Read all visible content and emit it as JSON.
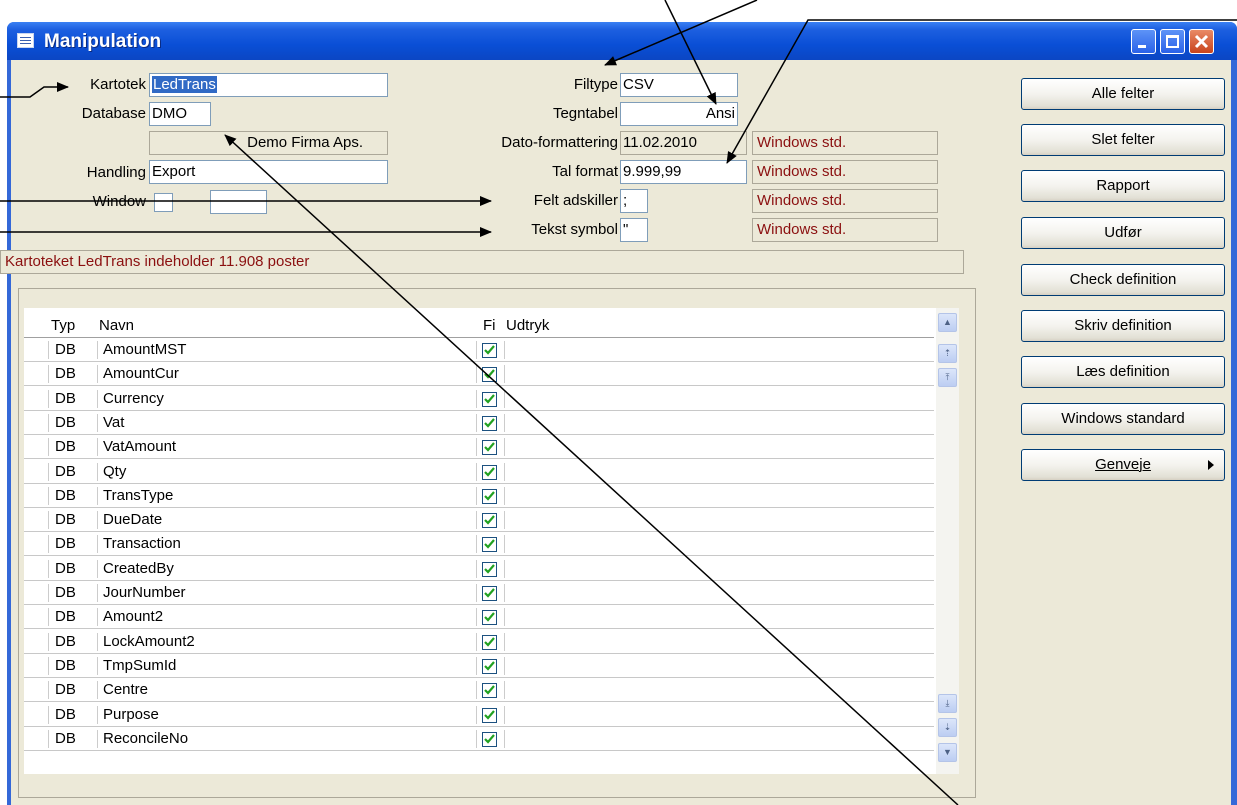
{
  "window": {
    "title": "Manipulation"
  },
  "form": {
    "kartotek_label": "Kartotek",
    "kartotek_value": "LedTrans",
    "database_label": "Database",
    "database_value": "DMO",
    "company_name": "Demo Firma Aps.",
    "handling_label": "Handling",
    "handling_value": "Export",
    "window_label": "Window",
    "window_value": "",
    "filtype_label": "Filtype",
    "filtype_value": "CSV",
    "tegntabel_label": "Tegntabel",
    "tegntabel_value": "Ansi",
    "dato_label": "Dato-formattering",
    "dato_value": "11.02.2010",
    "dato_std": "Windows std.",
    "tal_label": "Tal format",
    "tal_value": "9.999,99",
    "tal_std": "Windows std.",
    "felt_label": "Felt adskiller",
    "felt_value": ";",
    "felt_std": "Windows std.",
    "tekst_label": "Tekst symbol",
    "tekst_value": "\"",
    "tekst_std": "Windows std."
  },
  "status": {
    "message": "Kartoteket LedTrans indeholder 11.908 poster"
  },
  "buttons": {
    "alle_felter": "Alle felter",
    "slet_felter": "Slet felter",
    "rapport": "Rapport",
    "udfor": "Udfør",
    "check_definition": "Check definition",
    "skriv_definition": "Skriv definition",
    "laes_definition": "Læs definition",
    "windows_standard": "Windows standard",
    "genveje": "Genveje"
  },
  "grid": {
    "headers": {
      "typ": "Typ",
      "navn": "Navn",
      "fi": "Fi",
      "udtryk": "Udtryk"
    },
    "rows": [
      {
        "typ": "DB",
        "navn": "AmountMST",
        "checked": true
      },
      {
        "typ": "DB",
        "navn": "AmountCur",
        "checked": true
      },
      {
        "typ": "DB",
        "navn": "Currency",
        "checked": true
      },
      {
        "typ": "DB",
        "navn": "Vat",
        "checked": true
      },
      {
        "typ": "DB",
        "navn": "VatAmount",
        "checked": true
      },
      {
        "typ": "DB",
        "navn": "Qty",
        "checked": true
      },
      {
        "typ": "DB",
        "navn": "TransType",
        "checked": true
      },
      {
        "typ": "DB",
        "navn": "DueDate",
        "checked": true
      },
      {
        "typ": "DB",
        "navn": "Transaction",
        "checked": true
      },
      {
        "typ": "DB",
        "navn": "CreatedBy",
        "checked": true
      },
      {
        "typ": "DB",
        "navn": "JourNumber",
        "checked": true
      },
      {
        "typ": "DB",
        "navn": "Amount2",
        "checked": true
      },
      {
        "typ": "DB",
        "navn": "LockAmount2",
        "checked": true
      },
      {
        "typ": "DB",
        "navn": "TmpSumId",
        "checked": true
      },
      {
        "typ": "DB",
        "navn": "Centre",
        "checked": true
      },
      {
        "typ": "DB",
        "navn": "Purpose",
        "checked": true
      },
      {
        "typ": "DB",
        "navn": "ReconcileNo",
        "checked": true
      }
    ]
  }
}
